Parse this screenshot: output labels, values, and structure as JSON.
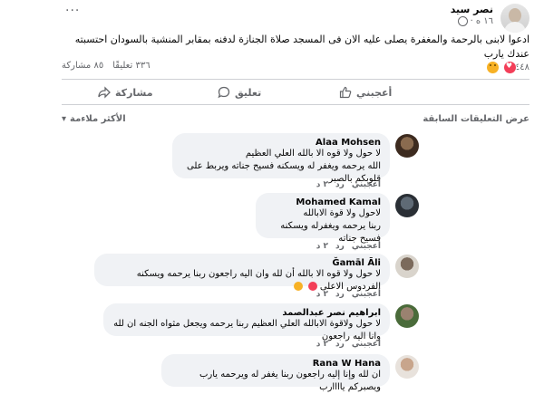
{
  "post": {
    "author": "نصر سيد",
    "time": "١٦ ه",
    "more": "...",
    "text": "ادعوا لابنى بالرحمة والمغفرة يصلى عليه الان فى المسجد صلاة الجنازة لدفنه بمقابر المنشية بالسودان  احتسبته عندك يارب",
    "reactions_count": "٤٤٨",
    "comments_count": "٣٣٦ تعليقًا",
    "shares_count": "٨٥ مشاركة"
  },
  "actions": {
    "like": "أعجبني",
    "comment": "تعليق",
    "share": "مشاركة"
  },
  "comments_header": {
    "sort": "الأكثر ملاءمة",
    "previous": "عرض التعليقات السابقة"
  },
  "comment_actions": {
    "like": "أعجبني",
    "reply": "رد",
    "time": "٢ د"
  },
  "comments": [
    {
      "name": "Alaa Mohsen",
      "line1": "لا حول ولا قوه الا بالله العلي العظيم",
      "line2": "الله يرحمه ويغفر له ويسكنه فسيح جناته ويربط على قلوبكم بالصبر"
    },
    {
      "name": "Mohamed Kamal",
      "line1": "لاحول ولا قوة الابالله",
      "line2": "ربنا يرحمه ويغفرله ويسكنه فسيح جناته"
    },
    {
      "name": "Ğamāl Āli",
      "line1": "لا حول ولا قوه الا بالله أن لله وان اليه راجعون ربنا يرحمه ويسكنه الفردوس الاعلى"
    },
    {
      "name": "ابراهيم نصر عبدالصمد",
      "line1": "لا حول ولاقوة الابالله العلي العظيم ربنا يرحمه ويجعل مثواه الجنه ان لله وانا اليه راجعون"
    },
    {
      "name": "Rana W Hana",
      "line1": "ان لله وإنا إليه راجعون ربنا يغفر له ويرحمه يارب ويصبركم ياااارب"
    }
  ],
  "colors": {
    "bubble": "#f0f2f5",
    "muted": "#65676b",
    "divider": "#ced0d4"
  }
}
